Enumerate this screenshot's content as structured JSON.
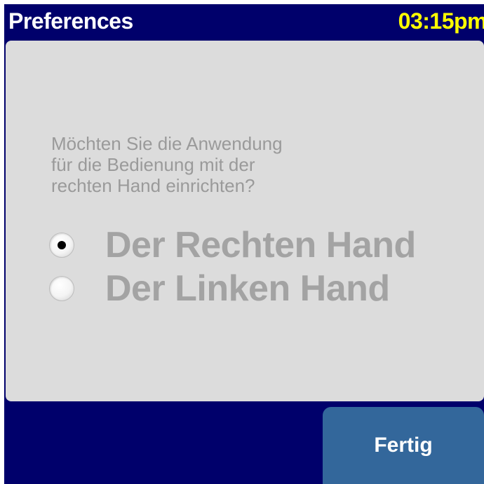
{
  "header": {
    "title": "Preferences",
    "time": "03:15pm"
  },
  "prompt": {
    "lines": [
      "Möchten Sie die Anwendung",
      "für die Bedienung mit der",
      "rechten Hand einrichten?"
    ]
  },
  "options": [
    {
      "label": "Der Rechten Hand",
      "selected": true
    },
    {
      "label": "Der Linken Hand",
      "selected": false
    }
  ],
  "footer": {
    "done_label": "Fertig"
  },
  "colors": {
    "frame": "#00006b",
    "panel": "#dcdcdc",
    "clock": "#ffff00",
    "button": "#33679b",
    "muted_text": "#a3a3a3"
  }
}
